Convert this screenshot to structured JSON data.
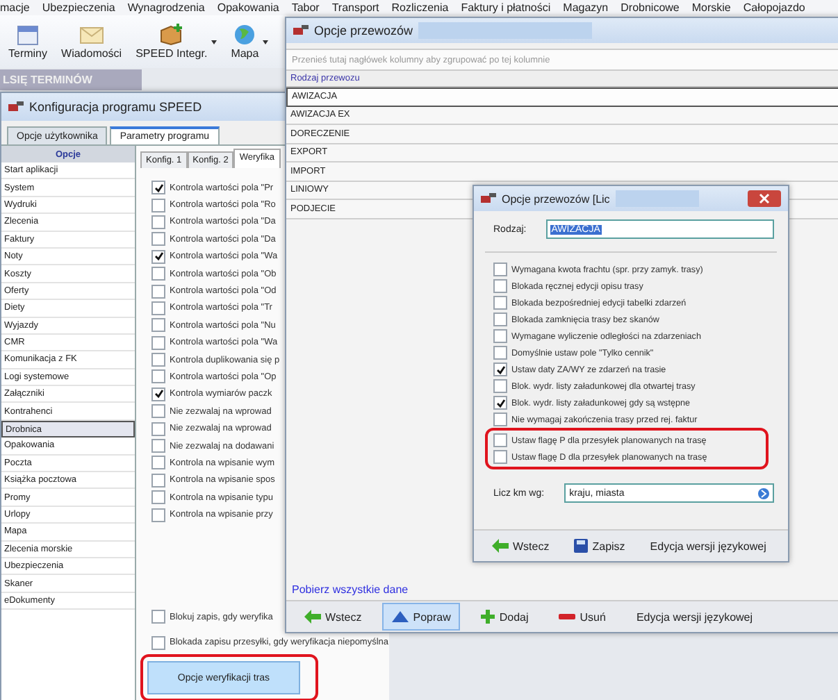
{
  "menu": [
    "macje",
    "Ubezpieczenia",
    "Wynagrodzenia",
    "Opakowania",
    "Tabor",
    "Transport",
    "Rozliczenia",
    "Faktury i płatności",
    "Magazyn",
    "Drobnicowe",
    "Morskie",
    "Całopojazdo"
  ],
  "toolbar": [
    {
      "label": "Terminy",
      "kind": "calendar",
      "dropdown": false
    },
    {
      "label": "Wiadomości",
      "kind": "mail",
      "dropdown": false
    },
    {
      "label": "SPEED Integr.",
      "kind": "package",
      "dropdown": true
    },
    {
      "label": "Mapa",
      "kind": "globe",
      "dropdown": true
    }
  ],
  "banner": "LSIĘ TERMINÓW",
  "config_window": {
    "title": "Konfiguracja programu SPEED",
    "tabs": [
      {
        "label": "Opcje użytkownika",
        "selected": false
      },
      {
        "label": "Parametry programu",
        "selected": true
      }
    ],
    "sidebar": {
      "header": "Opcje",
      "items": [
        {
          "label": "Start aplikacji",
          "selected": false
        },
        {
          "label": "System",
          "selected": false
        },
        {
          "label": "Wydruki",
          "selected": false
        },
        {
          "label": "Zlecenia",
          "selected": false
        },
        {
          "label": "Faktury",
          "selected": false
        },
        {
          "label": "Noty",
          "selected": false
        },
        {
          "label": "Koszty",
          "selected": false
        },
        {
          "label": "Oferty",
          "selected": false
        },
        {
          "label": "Diety",
          "selected": false
        },
        {
          "label": "Wyjazdy",
          "selected": false
        },
        {
          "label": "CMR",
          "selected": false
        },
        {
          "label": "Komunikacja z FK",
          "selected": false
        },
        {
          "label": "Logi systemowe",
          "selected": false
        },
        {
          "label": "Załączniki",
          "selected": false
        },
        {
          "label": "Kontrahenci",
          "selected": false
        },
        {
          "label": "Drobnica",
          "selected": true
        },
        {
          "label": "Opakowania",
          "selected": false
        },
        {
          "label": "Poczta",
          "selected": false
        },
        {
          "label": "Książka pocztowa",
          "selected": false
        },
        {
          "label": "Promy",
          "selected": false
        },
        {
          "label": "Urlopy",
          "selected": false
        },
        {
          "label": "Mapa",
          "selected": false
        },
        {
          "label": "Zlecenia morskie",
          "selected": false
        },
        {
          "label": "Ubezpieczenia",
          "selected": false
        },
        {
          "label": "Skaner",
          "selected": false
        },
        {
          "label": "eDokumenty",
          "selected": false
        }
      ]
    },
    "subtabs": [
      {
        "label": "Konfig. 1",
        "selected": false
      },
      {
        "label": "Konfig. 2",
        "selected": false
      },
      {
        "label": "Weryfika",
        "selected": true
      }
    ],
    "checks": [
      {
        "label": "Kontrola wartości pola \"Pr",
        "checked": true
      },
      {
        "label": "Kontrola wartości pola \"Ro",
        "checked": false
      },
      {
        "label": "Kontrola wartości pola \"Da",
        "checked": false
      },
      {
        "label": "Kontrola wartości pola \"Da",
        "checked": false
      },
      {
        "label": "Kontrola wartości pola \"Wa",
        "checked": true
      },
      {
        "label": "Kontrola wartości pola \"Ob",
        "checked": false
      },
      {
        "label": "Kontrola wartości pola \"Od",
        "checked": false
      },
      {
        "label": "Kontrola wartości pola \"Tr",
        "checked": false
      },
      {
        "label": "Kontrola wartości pola \"Nu",
        "checked": false
      },
      {
        "label": "Kontrola wartości pola \"Wa",
        "checked": false
      },
      {
        "label": "Kontrola duplikowania się p",
        "checked": false
      },
      {
        "label": "Kontrola wartości pola \"Op",
        "checked": false
      },
      {
        "label": "Kontrola wymiarów paczk",
        "checked": true
      },
      {
        "label": "Nie zezwalaj na wprowad",
        "checked": false
      },
      {
        "label": "Nie zezwalaj na wprowad",
        "checked": false
      },
      {
        "label": "Nie zezwalaj na dodawani",
        "checked": false
      },
      {
        "label": "Kontrola na wpisanie wym",
        "checked": false
      },
      {
        "label": "Kontrola na wpisanie spos",
        "checked": false
      },
      {
        "label": "Kontrola na wpisanie typu",
        "checked": false
      },
      {
        "label": "Kontrola na wpisanie przy",
        "checked": false
      }
    ],
    "lower_checks": [
      {
        "label": "Blokuj zapis, gdy weryfika",
        "checked": false
      },
      {
        "label": "Blokada zapisu przesyłki, gdy weryfikacja niepomyślna",
        "checked": false
      }
    ],
    "button": {
      "label": "Opcje weryfikacji tras",
      "highlighted": true
    }
  },
  "carrier_window": {
    "title": "Opcje przewozów",
    "group_hint": "Przenieś tutaj nagłówek kolumny aby zgrupować po tej kolumnie",
    "column": "Rodzaj przewozu",
    "rows": [
      {
        "label": "AWIZACJA",
        "selected": true
      },
      {
        "label": "AWIZACJA EX",
        "selected": false
      },
      {
        "label": "DORECZENIE",
        "selected": false
      },
      {
        "label": "EXPORT",
        "selected": false
      },
      {
        "label": "IMPORT",
        "selected": false
      },
      {
        "label": "LINIOWY",
        "selected": false
      },
      {
        "label": "PODJECIE",
        "selected": false
      }
    ],
    "link": "Pobierz wszystkie dane",
    "actions": [
      {
        "label": "Wstecz",
        "kind": "back",
        "selected": false
      },
      {
        "label": "Popraw",
        "kind": "edit",
        "selected": true
      },
      {
        "label": "Dodaj",
        "kind": "add",
        "selected": false
      },
      {
        "label": "Usuń",
        "kind": "remove",
        "selected": false
      },
      {
        "label": "Edycja wersji językowej",
        "kind": "text",
        "selected": false
      }
    ]
  },
  "dialog": {
    "title": "Opcje przewozów  [Lic",
    "type_label": "Rodzaj:",
    "type_value": "AWIZACJA",
    "checks": [
      {
        "label": "Wymagana kwota frachtu (spr. przy zamyk. trasy)",
        "checked": false,
        "highlighted": false
      },
      {
        "label": "Blokada ręcznej edycji opisu trasy",
        "checked": false,
        "highlighted": false
      },
      {
        "label": "Blokada bezpośredniej edycji tabelki zdarzeń",
        "checked": false,
        "highlighted": false
      },
      {
        "label": "Blokada zamknięcia trasy bez skanów",
        "checked": false,
        "highlighted": false
      },
      {
        "label": "Wymagane wyliczenie odległości na zdarzeniach",
        "checked": false,
        "highlighted": false
      },
      {
        "label": "Domyślnie ustaw pole \"Tylko cennik\"",
        "checked": false,
        "highlighted": false
      },
      {
        "label": "Ustaw daty ZA/WY ze zdarzeń na trasie",
        "checked": true,
        "highlighted": false
      },
      {
        "label": "Blok. wydr. listy załadunkowej dla otwartej trasy",
        "checked": false,
        "highlighted": false
      },
      {
        "label": "Blok. wydr. listy załadunkowej gdy są wstępne",
        "checked": true,
        "highlighted": false
      },
      {
        "label": "Nie wymagaj zakończenia trasy przed rej. faktur",
        "checked": false,
        "highlighted": false
      },
      {
        "label": "Ustaw flagę P dla przesyłek planowanych na trasę",
        "checked": false,
        "highlighted": true
      },
      {
        "label": "Ustaw flagę D dla przesyłek planowanych na trasę",
        "checked": false,
        "highlighted": true
      }
    ],
    "km_label": "Licz km wg:",
    "km_value": "kraju, miasta",
    "actions": [
      {
        "label": "Wstecz",
        "kind": "back",
        "selected": false
      },
      {
        "label": "Zapisz",
        "kind": "save",
        "selected": false
      },
      {
        "label": "Edycja wersji językowej",
        "kind": "text",
        "selected": false
      }
    ]
  }
}
